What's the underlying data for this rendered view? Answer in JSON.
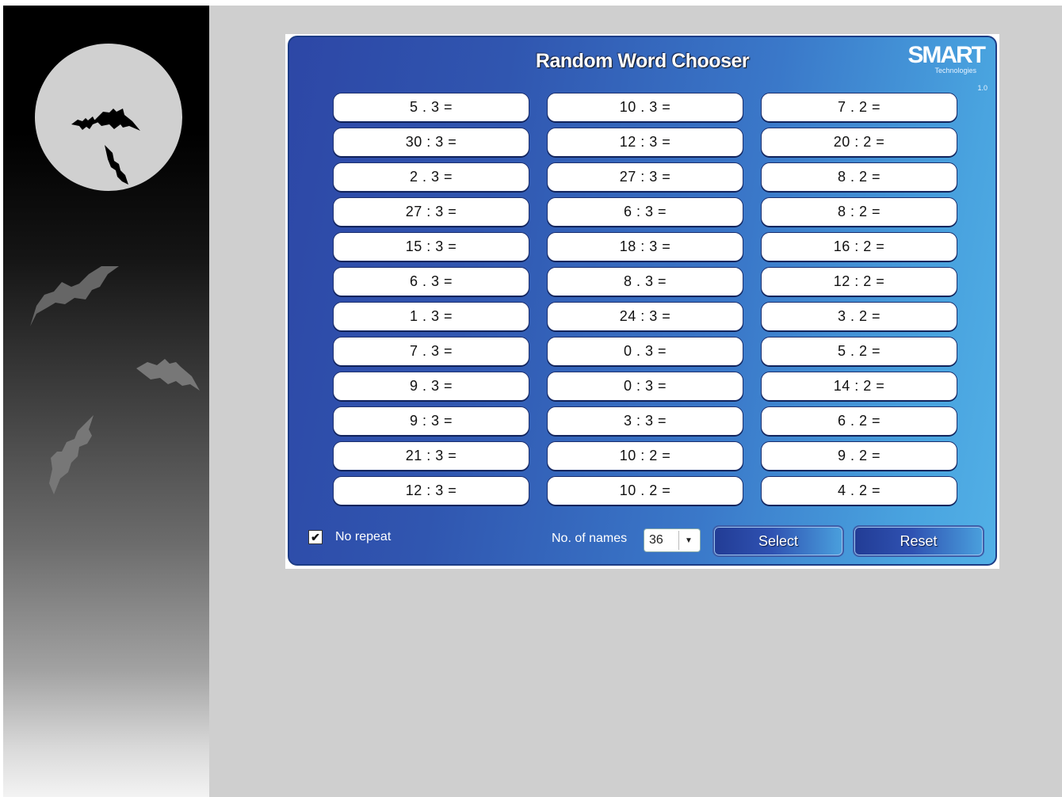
{
  "app": {
    "title": "Random Word Chooser",
    "logo_text": "SMART",
    "logo_sub": "Technologies",
    "version": "1.0"
  },
  "grid": {
    "columns": [
      [
        "5 . 3 =",
        "30 : 3 =",
        "2 . 3 =",
        "27 : 3 =",
        "15 : 3 =",
        "6 . 3 =",
        "1 . 3 =",
        "7 . 3 =",
        "9 . 3 =",
        "9 : 3 =",
        "21 : 3 =",
        "12 : 3 ="
      ],
      [
        "10 . 3 =",
        "12 : 3 =",
        "27 : 3 =",
        "6 : 3 =",
        "18 : 3 =",
        "8 . 3 =",
        "24 : 3 =",
        "0 . 3 =",
        "0 : 3 =",
        "3 : 3 =",
        "10 : 2 =",
        "10 . 2 ="
      ],
      [
        "7 . 2 =",
        "20 : 2 =",
        "8 . 2 =",
        "8 : 2 =",
        "16 : 2 =",
        "12 : 2 =",
        "3 . 2 =",
        "5 . 2 =",
        "14 : 2 =",
        "6 . 2 =",
        "9 . 2 =",
        "4 . 2 ="
      ]
    ]
  },
  "footer": {
    "no_repeat_label": "No repeat",
    "no_repeat_checked": true,
    "names_label": "No. of names",
    "names_value": "36",
    "select_label": "Select",
    "reset_label": "Reset"
  },
  "colors": {
    "panel_left": "#2d47a6",
    "panel_right": "#52b0e6",
    "stage": "#cfcfcf"
  }
}
